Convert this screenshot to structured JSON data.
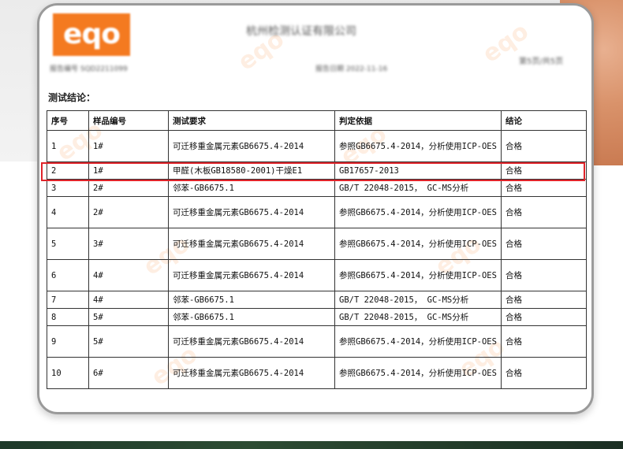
{
  "header": {
    "company_blurred": "杭州检测认证有限公司",
    "report_no_blurred": "报告编号 SQD2211099",
    "date_blurred": "报告日期 2022-11-16",
    "page_blurred": "第5页/共5页"
  },
  "logo_text": "eqo",
  "section_label": "测试结论：",
  "table": {
    "headers": [
      "序号",
      "样品编号",
      "测试要求",
      "判定依据",
      "结论"
    ],
    "rows": [
      [
        "1",
        "1#",
        "可迁移重金属元素GB6675.4-2014",
        "参照GB6675.4-2014，分析使用ICP-OES",
        "合格"
      ],
      [
        "2",
        "1#",
        "甲醛(木板GB18580-2001)干燥E1",
        "GB17657-2013",
        "合格"
      ],
      [
        "3",
        "2#",
        "邻苯-GB6675.1",
        "GB/T 22048-2015， GC-MS分析",
        "合格"
      ],
      [
        "4",
        "2#",
        "可迁移重金属元素GB6675.4-2014",
        "参照GB6675.4-2014，分析使用ICP-OES",
        "合格"
      ],
      [
        "5",
        "3#",
        "可迁移重金属元素GB6675.4-2014",
        "参照GB6675.4-2014，分析使用ICP-OES",
        "合格"
      ],
      [
        "6",
        "4#",
        "可迁移重金属元素GB6675.4-2014",
        "参照GB6675.4-2014，分析使用ICP-OES",
        "合格"
      ],
      [
        "7",
        "4#",
        "邻苯-GB6675.1",
        "GB/T 22048-2015， GC-MS分析",
        "合格"
      ],
      [
        "8",
        "5#",
        "邻苯-GB6675.1",
        "GB/T 22048-2015， GC-MS分析",
        "合格"
      ],
      [
        "9",
        "5#",
        "可迁移重金属元素GB6675.4-2014",
        "参照GB6675.4-2014，分析使用ICP-OES",
        "合格"
      ],
      [
        "10",
        "6#",
        "可迁移重金属元素GB6675.4-2014",
        "参照GB6675.4-2014，分析使用ICP-OES",
        "合格"
      ]
    ],
    "highlighted_row": 2
  },
  "colors": {
    "brand": "#f47a20",
    "highlight": "#e0242a"
  }
}
